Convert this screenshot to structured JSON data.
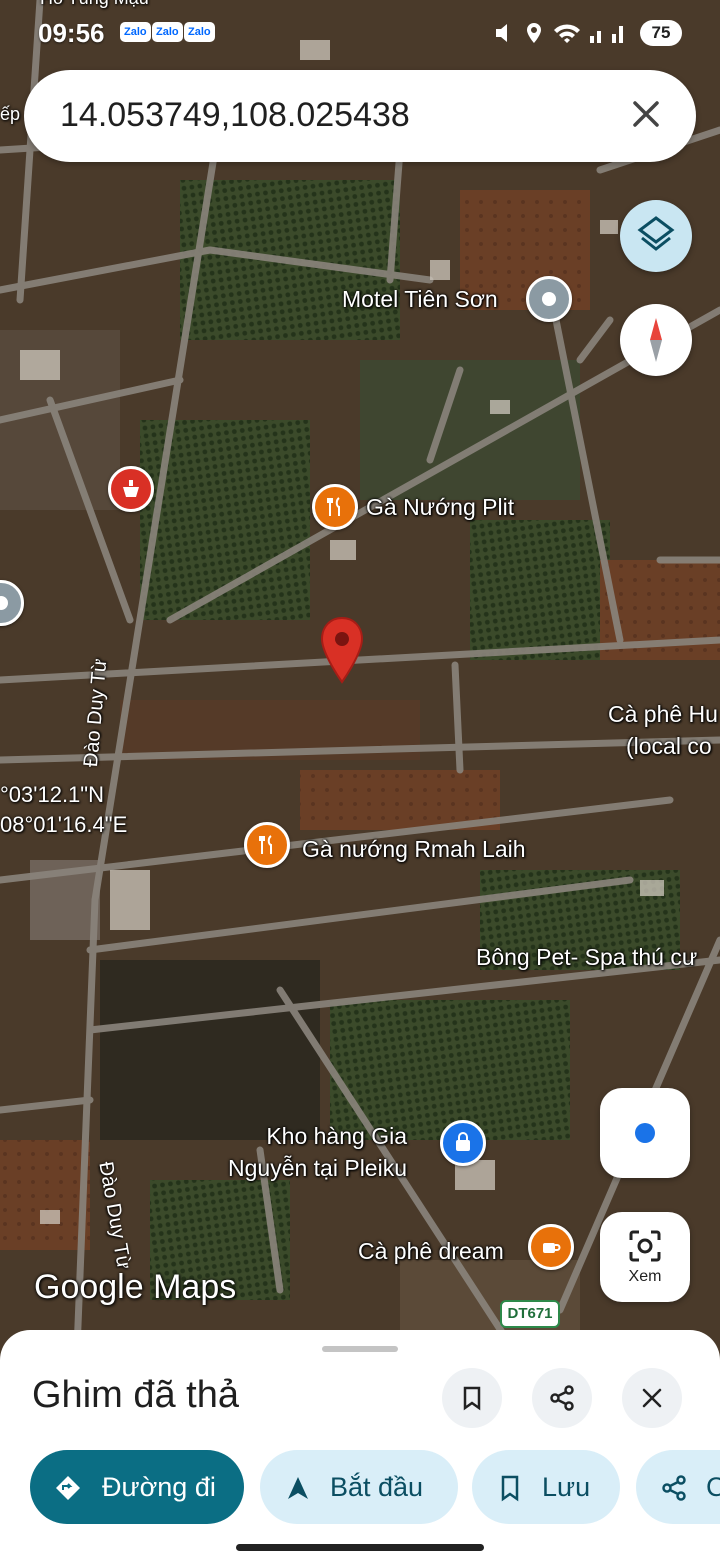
{
  "status_bar": {
    "time": "09:56",
    "apps": [
      "Zalo",
      "Zalo",
      "Zalo"
    ],
    "icons": [
      "mute-icon",
      "location-icon",
      "wifi-icon",
      "signal-icon"
    ],
    "battery": "75"
  },
  "search": {
    "query": "14.053749,108.025438"
  },
  "map": {
    "pois": [
      {
        "name": "Motel Tiên Sơn",
        "icon": "hotel-pin"
      },
      {
        "name": "Gà Nướng Plit",
        "icon": "restaurant-pin"
      },
      {
        "name": "Cà phê Hu",
        "line2": "(local co",
        "icon": "none"
      },
      {
        "name": "Gà nướng Rmah Laih",
        "icon": "restaurant-pin"
      },
      {
        "name": "Bông Pet- Spa thú cư",
        "icon": "none"
      },
      {
        "name": "Kho hàng Gia",
        "line2": "Nguyễn tại Pleiku",
        "icon": "store-pin"
      },
      {
        "name": "Cà phê dream",
        "icon": "cafe-pin"
      }
    ],
    "roads": [
      "Đào Duy Từ",
      "Đào Duy Từ"
    ],
    "route_badge": "DT671",
    "coords": {
      "lat": "°03'12.1\"N",
      "lng": "08°01'16.4\"E"
    },
    "side_label": "ếp",
    "top_label": "Hồ Tùng Mậu",
    "watermark": "Google Maps",
    "lens_label": "Xem"
  },
  "sheet": {
    "title": "Ghim đã thả",
    "chips": [
      {
        "label": "Đường đi",
        "icon": "directions-icon"
      },
      {
        "label": "Bắt đầu",
        "icon": "navigation-icon"
      },
      {
        "label": "Lưu",
        "icon": "bookmark-icon"
      },
      {
        "label": "C",
        "icon": "share-icon"
      }
    ]
  },
  "colors": {
    "accent": "#0b6e84",
    "chip_bg": "#d9eef8",
    "pin_red": "#d93025",
    "food_orange": "#e8710a",
    "store_blue": "#1a73e8"
  }
}
